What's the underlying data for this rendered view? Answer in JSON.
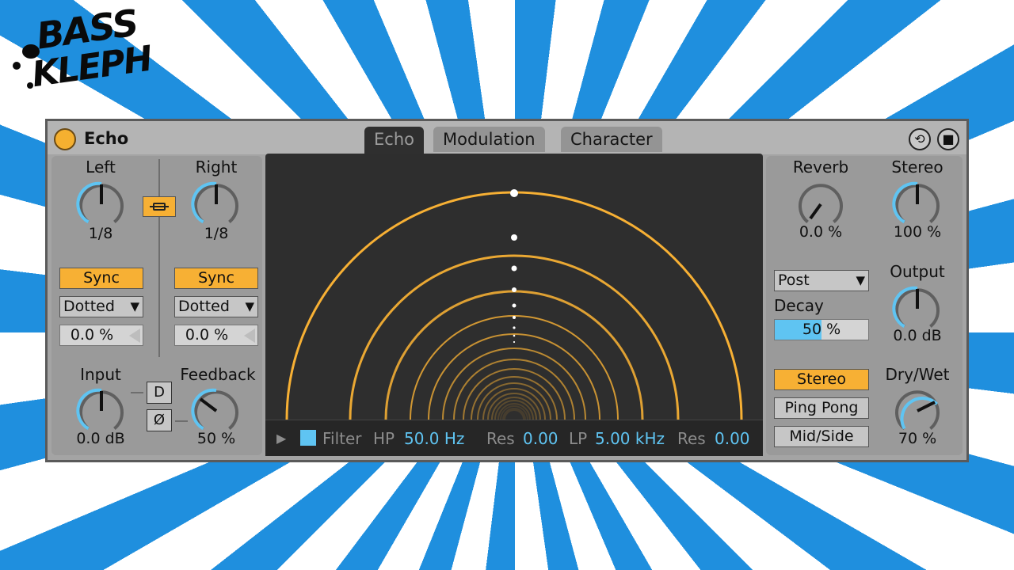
{
  "logo": {
    "line1": "BASS",
    "line2": "KLEPH"
  },
  "device": {
    "title": "Echo",
    "tabs": [
      {
        "label": "Echo",
        "active": true
      },
      {
        "label": "Modulation",
        "active": false
      },
      {
        "label": "Character",
        "active": false
      }
    ],
    "header_icons": [
      "hot-swap-icon",
      "save-preset-icon"
    ]
  },
  "left_section": {
    "left": {
      "label": "Left",
      "value": "1/8",
      "sync_label": "Sync",
      "mode": "Dotted",
      "offset": "0.0 %"
    },
    "right": {
      "label": "Right",
      "value": "1/8",
      "sync_label": "Sync",
      "mode": "Dotted",
      "offset": "0.0 %"
    },
    "link_icon": "link-icon",
    "input": {
      "label": "Input",
      "value": "0.0 dB",
      "level": 0.5
    },
    "feedback": {
      "label": "Feedback",
      "value": "50 %",
      "level": 0.5
    },
    "d_button": "D",
    "phase_button": "Ø"
  },
  "display": {
    "filter_toggle_icon": "play-triangle-icon",
    "filter_label": "Filter",
    "hp_label": "HP",
    "hp_value": "50.0 Hz",
    "res1_label": "Res",
    "res1_value": "0.00",
    "lp_label": "LP",
    "lp_value": "5.00 kHz",
    "res2_label": "Res",
    "res2_value": "0.00"
  },
  "right_section": {
    "reverb": {
      "label": "Reverb",
      "value": "0.0 %",
      "level": 0.0
    },
    "stereo": {
      "label": "Stereo",
      "value": "100 %",
      "level": 0.5
    },
    "reverb_position": "Post",
    "decay": {
      "label": "Decay",
      "value": "50 %",
      "level": 0.5
    },
    "output": {
      "label": "Output",
      "value": "0.0 dB",
      "level": 0.5
    },
    "modes": [
      {
        "label": "Stereo",
        "active": true
      },
      {
        "label": "Ping Pong",
        "active": false
      },
      {
        "label": "Mid/Side",
        "active": false
      }
    ],
    "dry_wet": {
      "label": "Dry/Wet",
      "value": "70 %",
      "level": 0.7
    }
  },
  "colors": {
    "accent": "#f7b034",
    "blue": "#5fc4f2",
    "display_bg": "#2e2e2e",
    "panel": "#9a9a9a",
    "stripe_blue": "#1f8fde"
  }
}
